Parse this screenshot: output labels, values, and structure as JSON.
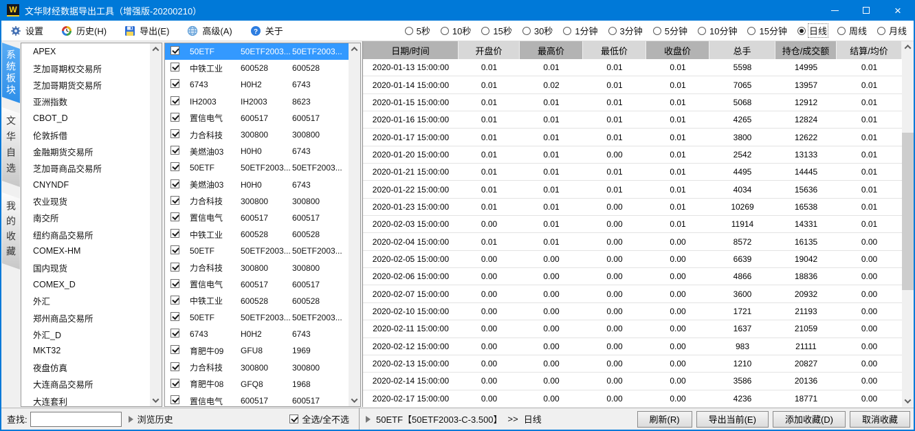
{
  "window": {
    "logo": "W",
    "title": "文华财经数据导出工具（增强版-20200210）"
  },
  "toolbar": {
    "settings": "设置",
    "history": "历史(H)",
    "export": "导出(E)",
    "advanced": "高级(A)",
    "about": "关于",
    "periods": [
      {
        "label": "5秒",
        "selected": false
      },
      {
        "label": "10秒",
        "selected": false
      },
      {
        "label": "15秒",
        "selected": false
      },
      {
        "label": "30秒",
        "selected": false
      },
      {
        "label": "1分钟",
        "selected": false
      },
      {
        "label": "3分钟",
        "selected": false
      },
      {
        "label": "5分钟",
        "selected": false
      },
      {
        "label": "10分钟",
        "selected": false
      },
      {
        "label": "15分钟",
        "selected": false
      },
      {
        "label": "日线",
        "selected": true
      },
      {
        "label": "周线",
        "selected": false
      },
      {
        "label": "月线",
        "selected": false
      }
    ]
  },
  "sidebar": {
    "tabs": [
      {
        "label": "系统板块",
        "selected": true
      },
      {
        "label": "文华自选",
        "selected": false
      },
      {
        "label": "我的收藏",
        "selected": false
      }
    ],
    "items": [
      "APEX",
      "芝加哥期权交易所",
      "芝加哥期货交易所",
      "亚洲指数",
      "CBOT_D",
      "伦敦拆借",
      "金融期货交易所",
      "芝加哥商品交易所",
      "CNYNDF",
      "农业现货",
      "南交所",
      "纽约商品交易所",
      "COMEX-HM",
      "国内现货",
      "COMEX_D",
      "外汇",
      "郑州商品交易所",
      "外汇_D",
      "MKT32",
      "夜盘仿真",
      "大连商品交易所",
      "大连套利"
    ]
  },
  "instruments": [
    {
      "checked": true,
      "selected": true,
      "name": "50ETF",
      "code1": "50ETF2003...",
      "code2": "50ETF2003..."
    },
    {
      "checked": true,
      "selected": false,
      "name": "中铁工业",
      "code1": "600528",
      "code2": "600528"
    },
    {
      "checked": true,
      "selected": false,
      "name": "6743",
      "code1": "H0H2",
      "code2": "6743"
    },
    {
      "checked": true,
      "selected": false,
      "name": "IH2003",
      "code1": "IH2003",
      "code2": "8623"
    },
    {
      "checked": true,
      "selected": false,
      "name": "置信电气",
      "code1": "600517",
      "code2": "600517"
    },
    {
      "checked": true,
      "selected": false,
      "name": "力合科技",
      "code1": "300800",
      "code2": "300800"
    },
    {
      "checked": true,
      "selected": false,
      "name": "美燃油03",
      "code1": "H0H0",
      "code2": "6743"
    },
    {
      "checked": true,
      "selected": false,
      "name": "50ETF",
      "code1": "50ETF2003...",
      "code2": "50ETF2003..."
    },
    {
      "checked": true,
      "selected": false,
      "name": "美燃油03",
      "code1": "H0H0",
      "code2": "6743"
    },
    {
      "checked": true,
      "selected": false,
      "name": "力合科技",
      "code1": "300800",
      "code2": "300800"
    },
    {
      "checked": true,
      "selected": false,
      "name": "置信电气",
      "code1": "600517",
      "code2": "600517"
    },
    {
      "checked": true,
      "selected": false,
      "name": "中铁工业",
      "code1": "600528",
      "code2": "600528"
    },
    {
      "checked": true,
      "selected": false,
      "name": "50ETF",
      "code1": "50ETF2003...",
      "code2": "50ETF2003..."
    },
    {
      "checked": true,
      "selected": false,
      "name": "力合科技",
      "code1": "300800",
      "code2": "300800"
    },
    {
      "checked": true,
      "selected": false,
      "name": "置信电气",
      "code1": "600517",
      "code2": "600517"
    },
    {
      "checked": true,
      "selected": false,
      "name": "中铁工业",
      "code1": "600528",
      "code2": "600528"
    },
    {
      "checked": true,
      "selected": false,
      "name": "50ETF",
      "code1": "50ETF2003...",
      "code2": "50ETF2003..."
    },
    {
      "checked": true,
      "selected": false,
      "name": "6743",
      "code1": "H0H2",
      "code2": "6743"
    },
    {
      "checked": true,
      "selected": false,
      "name": "育肥牛09",
      "code1": "GFU8",
      "code2": "1969"
    },
    {
      "checked": true,
      "selected": false,
      "name": "力合科技",
      "code1": "300800",
      "code2": "300800"
    },
    {
      "checked": true,
      "selected": false,
      "name": "育肥牛08",
      "code1": "GFQ8",
      "code2": "1968"
    },
    {
      "checked": true,
      "selected": false,
      "name": "置信电气",
      "code1": "600517",
      "code2": "600517"
    }
  ],
  "table": {
    "columns": [
      "日期/时间",
      "开盘价",
      "最高价",
      "最低价",
      "收盘价",
      "总手",
      "持仓/成交额",
      "结算/均价"
    ],
    "rows": [
      [
        "2020-01-13 15:00:00",
        "0.01",
        "0.01",
        "0.01",
        "0.01",
        "5598",
        "14995",
        "0.01"
      ],
      [
        "2020-01-14 15:00:00",
        "0.01",
        "0.02",
        "0.01",
        "0.01",
        "7065",
        "13957",
        "0.01"
      ],
      [
        "2020-01-15 15:00:00",
        "0.01",
        "0.01",
        "0.01",
        "0.01",
        "5068",
        "12912",
        "0.01"
      ],
      [
        "2020-01-16 15:00:00",
        "0.01",
        "0.01",
        "0.01",
        "0.01",
        "4265",
        "12824",
        "0.01"
      ],
      [
        "2020-01-17 15:00:00",
        "0.01",
        "0.01",
        "0.01",
        "0.01",
        "3800",
        "12622",
        "0.01"
      ],
      [
        "2020-01-20 15:00:00",
        "0.01",
        "0.01",
        "0.00",
        "0.01",
        "2542",
        "13133",
        "0.01"
      ],
      [
        "2020-01-21 15:00:00",
        "0.01",
        "0.01",
        "0.01",
        "0.01",
        "4495",
        "14445",
        "0.01"
      ],
      [
        "2020-01-22 15:00:00",
        "0.01",
        "0.01",
        "0.01",
        "0.01",
        "4034",
        "15636",
        "0.01"
      ],
      [
        "2020-01-23 15:00:00",
        "0.01",
        "0.01",
        "0.00",
        "0.01",
        "10269",
        "16538",
        "0.01"
      ],
      [
        "2020-02-03 15:00:00",
        "0.00",
        "0.01",
        "0.00",
        "0.01",
        "11914",
        "14331",
        "0.01"
      ],
      [
        "2020-02-04 15:00:00",
        "0.01",
        "0.01",
        "0.00",
        "0.00",
        "8572",
        "16135",
        "0.00"
      ],
      [
        "2020-02-05 15:00:00",
        "0.00",
        "0.00",
        "0.00",
        "0.00",
        "6639",
        "19042",
        "0.00"
      ],
      [
        "2020-02-06 15:00:00",
        "0.00",
        "0.00",
        "0.00",
        "0.00",
        "4866",
        "18836",
        "0.00"
      ],
      [
        "2020-02-07 15:00:00",
        "0.00",
        "0.00",
        "0.00",
        "0.00",
        "3600",
        "20932",
        "0.00"
      ],
      [
        "2020-02-10 15:00:00",
        "0.00",
        "0.00",
        "0.00",
        "0.00",
        "1721",
        "21193",
        "0.00"
      ],
      [
        "2020-02-11 15:00:00",
        "0.00",
        "0.00",
        "0.00",
        "0.00",
        "1637",
        "21059",
        "0.00"
      ],
      [
        "2020-02-12 15:00:00",
        "0.00",
        "0.00",
        "0.00",
        "0.00",
        "983",
        "21111",
        "0.00"
      ],
      [
        "2020-02-13 15:00:00",
        "0.00",
        "0.00",
        "0.00",
        "0.00",
        "1210",
        "20827",
        "0.00"
      ],
      [
        "2020-02-14 15:00:00",
        "0.00",
        "0.00",
        "0.00",
        "0.00",
        "3586",
        "20136",
        "0.00"
      ],
      [
        "2020-02-17 15:00:00",
        "0.00",
        "0.00",
        "0.00",
        "0.00",
        "4236",
        "18771",
        "0.00"
      ]
    ]
  },
  "footer": {
    "search_label": "查找:",
    "search_value": "",
    "browse_history": "浏览历史",
    "select_all": "全选/全不选",
    "select_all_checked": true,
    "status_instrument": "50ETF【50ETF2003-C-3.500】",
    "status_sep": ">>",
    "status_period": "日线",
    "refresh": "刷新(R)",
    "export_current": "导出当前(E)",
    "add_favorite": "添加收藏(D)",
    "remove_favorite": "取消收藏"
  },
  "colors": {
    "titlebar": "#0079d8",
    "selection_blue": "#3399ff",
    "tab_active_blue": "#3f9bf0",
    "header_dark": "#b3b3b3",
    "header_light": "#d8d8d8",
    "footer_bg": "#f0f0f0"
  }
}
